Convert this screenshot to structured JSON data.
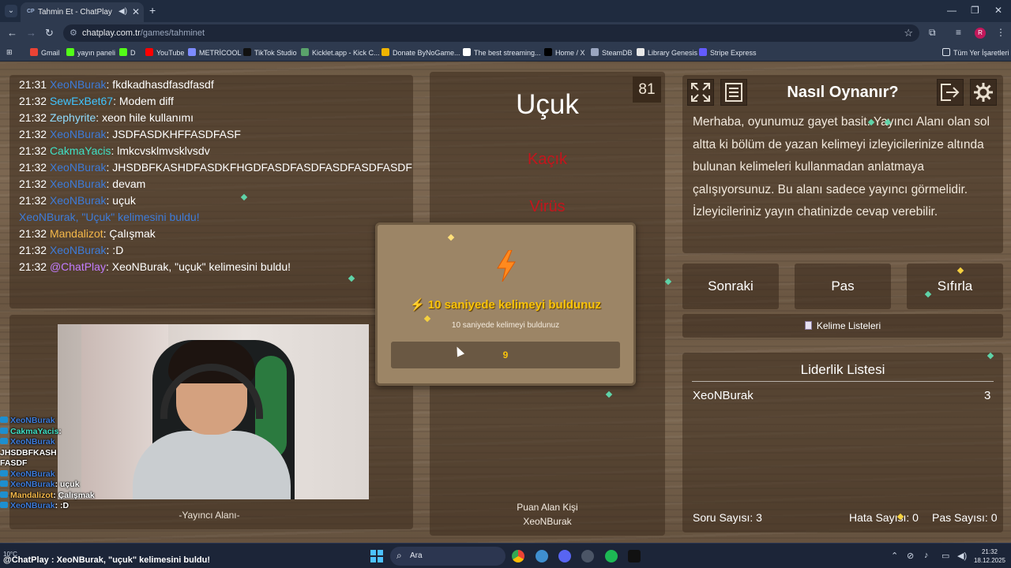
{
  "browser": {
    "tab_title": "Tahmin Et - ChatPlay",
    "tab_favicon": "CP",
    "url_domain": "chatplay.com.tr",
    "url_path": "/games/tahminet",
    "bookmarks": [
      "Gmail",
      "yayın paneli",
      "D",
      "YouTube",
      "METRİCOOL",
      "TikTok Studio",
      "Kicklet.app - Kick C...",
      "Donate ByNoGame...",
      "The best streaming...",
      "Home / X",
      "SteamDB",
      "Library Genesis",
      "Stripe Express"
    ],
    "bookmarks_all": "Tüm Yer İşaretleri",
    "profile_initial": "R"
  },
  "chat": [
    {
      "time": "21:31",
      "user": "XeoNBurak",
      "color": "#3d7bd9",
      "msg": ": fkdkadhasdfasdfasdf"
    },
    {
      "time": "21:32",
      "user": "SewExBet67",
      "color": "#3fc4ff",
      "msg": ": Modem diff"
    },
    {
      "time": "21:32",
      "user": "Zephyrite",
      "color": "#8fdcff",
      "msg": ": xeon hile kullanımı"
    },
    {
      "time": "21:32",
      "user": "XeoNBurak",
      "color": "#3d7bd9",
      "msg": ": JSDFASDKHFFASDFASF"
    },
    {
      "time": "21:32",
      "user": "CakmaYacis",
      "color": "#3fe0c5",
      "msg": ": lmkcvsklmvsklvsdv"
    },
    {
      "time": "21:32",
      "user": "XeoNBurak",
      "color": "#3d7bd9",
      "msg": ": JHSDBFKASHDFASDKFHGDFASDFASDFASDFASDFASDF"
    },
    {
      "time": "21:32",
      "user": "XeoNBurak",
      "color": "#3d7bd9",
      "msg": ": devam"
    },
    {
      "time": "21:32",
      "user": "XeoNBurak",
      "color": "#3d7bd9",
      "msg": ": uçuk"
    },
    {
      "time": "",
      "user": "",
      "color": "#3d7bd9",
      "msg": "XeoNBurak, \"Uçuk\" kelimesini buldu!"
    },
    {
      "time": "21:32",
      "user": "Mandalizot",
      "color": "#f5b84a",
      "msg": ": Çalışmak"
    },
    {
      "time": "21:32",
      "user": "XeoNBurak",
      "color": "#3d7bd9",
      "msg": ": :D"
    },
    {
      "time": "21:32",
      "user": "@ChatPlay",
      "color": "#c27cff",
      "msg": ": XeoNBurak, \"uçuk\" kelimesini buldu!"
    }
  ],
  "overlay_chat": [
    {
      "user": "XeoNBurak",
      "color": "#3d7bd9",
      "msg": ""
    },
    {
      "user": "CakmaYacis",
      "color": "#3fe0c5",
      "msg": ":"
    },
    {
      "user": "XeoNBurak",
      "color": "#3d7bd9",
      "msg": ""
    },
    {
      "user": "",
      "color": "#ffffff",
      "msg": "JHSDBFKASH"
    },
    {
      "user": "",
      "color": "#ffffff",
      "msg": "FASDF"
    },
    {
      "user": "XeoNBurak",
      "color": "#3d7bd9",
      "msg": ""
    },
    {
      "user": "XeoNBurak",
      "color": "#3d7bd9",
      "msg": ": uçuk"
    },
    {
      "user": "Mandalizot",
      "color": "#f5b84a",
      "msg": ": Çalışmak"
    },
    {
      "user": "XeoNBurak",
      "color": "#3d7bd9",
      "msg": ": :D"
    }
  ],
  "streamer_area_label": "-Yayıncı Alanı-",
  "game": {
    "word": "Uçuk",
    "counter": "81",
    "forbidden": [
      "Kaçık",
      "Virüs"
    ],
    "points_label": "Puan Alan Kişi",
    "points_user": "XeoNBurak"
  },
  "modal": {
    "title": "10 saniyede kelimeyi buldunuz",
    "subtitle": "10 saniyede kelimeyi buldunuz",
    "countdown": "9"
  },
  "how_to": {
    "title": "Nasıl Oynanır?",
    "text": "Merhaba, oyunumuz gayet basit. Yayıncı Alanı olan sol altta ki bölüm de yazan kelimeyi izleyicilerinize altında bulunan kelimeleri kullanmadan anlatmaya çalışıyorsunuz. Bu alanı sadece yayıncı görmelidir. İzleyicileriniz yayın chatinizde cevap verebilir."
  },
  "buttons": {
    "next": "Sonraki",
    "pass": "Pas",
    "reset": "Sıfırla",
    "word_lists": "Kelime Listeleri"
  },
  "leaderboard": {
    "title": "Liderlik Listesi",
    "entries": [
      {
        "name": "XeoNBurak",
        "score": "3"
      }
    ]
  },
  "stats": {
    "questions": "Soru Sayısı: 3",
    "errors": "Hata Sayısı: 0",
    "passes": "Pas Sayısı: 0"
  },
  "taskbar": {
    "weather": "10°C",
    "ticker": "@ChatPlay : XeoNBurak, \"uçuk\" kelimesini buldu!",
    "search_placeholder": "Ara",
    "time": "21:32",
    "date": "18.12.2025"
  }
}
